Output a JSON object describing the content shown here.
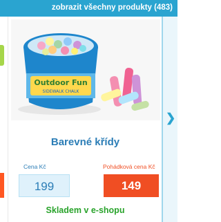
{
  "header": {
    "link_label": "zobrazit všechny produkty (483)"
  },
  "product": {
    "title": "Barevné křídy",
    "price_label": "Cena Kč",
    "price": "199",
    "fairy_price_label": "Pohádková cena Kč",
    "fairy_price": "149",
    "stock_status": "Skladem v e-shopu",
    "image_brand_text": "Outdoor Fun",
    "image_sub_text": "SIDEWALK CHALK"
  },
  "colors": {
    "accent": "#2aa4d0",
    "price_highlight": "#f04e23",
    "stock": "#29a32b"
  },
  "icons": {
    "next": "chevron-right-icon"
  }
}
